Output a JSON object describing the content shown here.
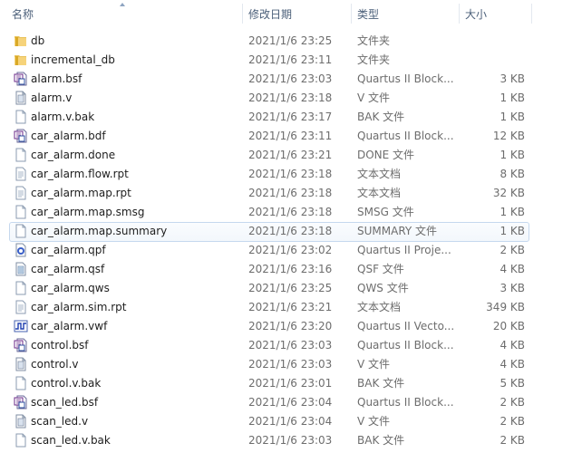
{
  "columns": {
    "name": "名称",
    "date": "修改日期",
    "type": "类型",
    "size": "大小"
  },
  "files": [
    {
      "name": "db",
      "date": "2021/1/6 23:25",
      "type": "文件夹",
      "size": "",
      "icon": "folder-icon"
    },
    {
      "name": "incremental_db",
      "date": "2021/1/6 23:11",
      "type": "文件夹",
      "size": "",
      "icon": "folder-icon"
    },
    {
      "name": "alarm.bsf",
      "date": "2021/1/6 23:03",
      "type": "Quartus II Block...",
      "size": "3 KB",
      "icon": "block-file-icon"
    },
    {
      "name": "alarm.v",
      "date": "2021/1/6 23:18",
      "type": "V 文件",
      "size": "1 KB",
      "icon": "text-file-icon"
    },
    {
      "name": "alarm.v.bak",
      "date": "2021/1/6 23:17",
      "type": "BAK 文件",
      "size": "1 KB",
      "icon": "blank-file-icon"
    },
    {
      "name": "car_alarm.bdf",
      "date": "2021/1/6 23:11",
      "type": "Quartus II Block...",
      "size": "12 KB",
      "icon": "block-file-icon"
    },
    {
      "name": "car_alarm.done",
      "date": "2021/1/6 23:21",
      "type": "DONE 文件",
      "size": "1 KB",
      "icon": "blank-file-icon"
    },
    {
      "name": "car_alarm.flow.rpt",
      "date": "2021/1/6 23:18",
      "type": "文本文档",
      "size": "8 KB",
      "icon": "text-doc-icon"
    },
    {
      "name": "car_alarm.map.rpt",
      "date": "2021/1/6 23:18",
      "type": "文本文档",
      "size": "32 KB",
      "icon": "text-doc-icon"
    },
    {
      "name": "car_alarm.map.smsg",
      "date": "2021/1/6 23:18",
      "type": "SMSG 文件",
      "size": "1 KB",
      "icon": "blank-file-icon"
    },
    {
      "name": "car_alarm.map.summary",
      "date": "2021/1/6 23:18",
      "type": "SUMMARY 文件",
      "size": "1 KB",
      "icon": "blank-file-icon",
      "selected": true
    },
    {
      "name": "car_alarm.qpf",
      "date": "2021/1/6 23:02",
      "type": "Quartus II Proje...",
      "size": "2 KB",
      "icon": "project-file-icon"
    },
    {
      "name": "car_alarm.qsf",
      "date": "2021/1/6 23:16",
      "type": "QSF 文件",
      "size": "4 KB",
      "icon": "settings-file-icon"
    },
    {
      "name": "car_alarm.qws",
      "date": "2021/1/6 23:25",
      "type": "QWS 文件",
      "size": "3 KB",
      "icon": "blank-file-icon"
    },
    {
      "name": "car_alarm.sim.rpt",
      "date": "2021/1/6 23:21",
      "type": "文本文档",
      "size": "349 KB",
      "icon": "text-doc-icon"
    },
    {
      "name": "car_alarm.vwf",
      "date": "2021/1/6 23:20",
      "type": "Quartus II Vecto...",
      "size": "20 KB",
      "icon": "waveform-file-icon"
    },
    {
      "name": "control.bsf",
      "date": "2021/1/6 23:03",
      "type": "Quartus II Block...",
      "size": "4 KB",
      "icon": "block-file-icon"
    },
    {
      "name": "control.v",
      "date": "2021/1/6 23:03",
      "type": "V 文件",
      "size": "4 KB",
      "icon": "text-file-icon"
    },
    {
      "name": "control.v.bak",
      "date": "2021/1/6 23:01",
      "type": "BAK 文件",
      "size": "5 KB",
      "icon": "blank-file-icon"
    },
    {
      "name": "scan_led.bsf",
      "date": "2021/1/6 23:04",
      "type": "Quartus II Block...",
      "size": "2 KB",
      "icon": "block-file-icon"
    },
    {
      "name": "scan_led.v",
      "date": "2021/1/6 23:04",
      "type": "V 文件",
      "size": "2 KB",
      "icon": "text-file-icon"
    },
    {
      "name": "scan_led.v.bak",
      "date": "2021/1/6 23:03",
      "type": "BAK 文件",
      "size": "2 KB",
      "icon": "blank-file-icon"
    }
  ]
}
